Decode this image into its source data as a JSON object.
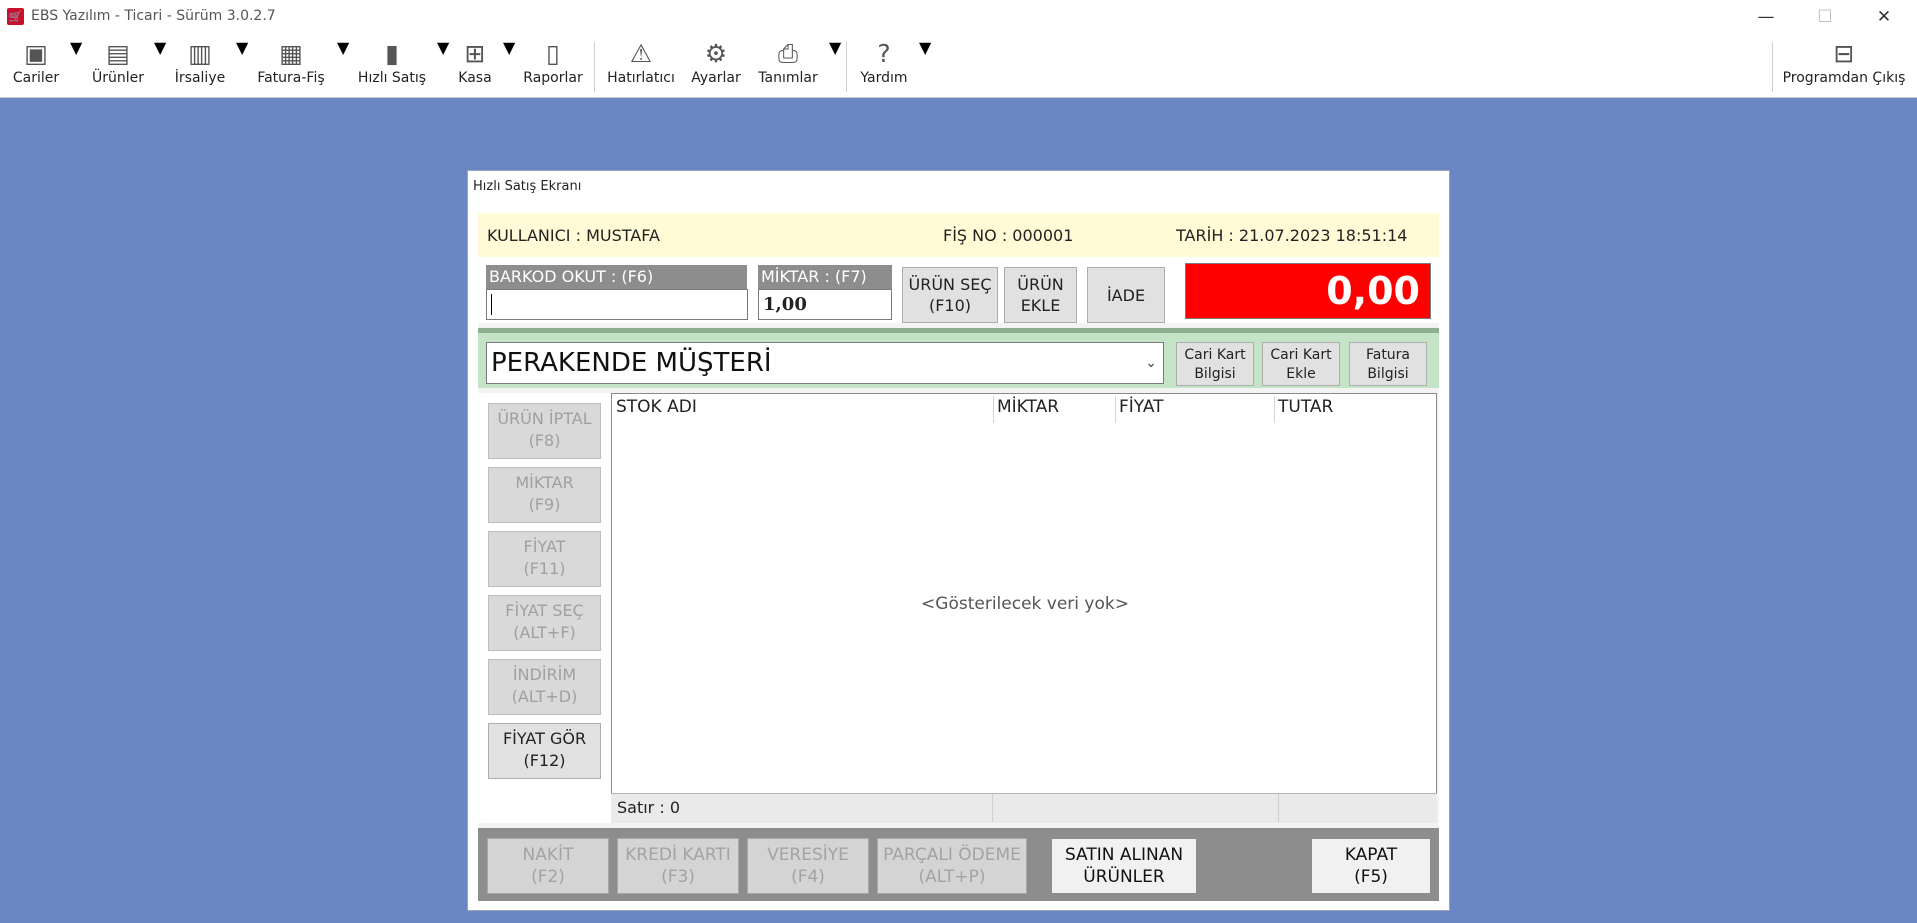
{
  "window": {
    "title": "EBS Yazılım - Ticari - Sürüm 3.0.2.7"
  },
  "toolbar": {
    "items": [
      {
        "label": "Cariler",
        "icon": "safe-icon"
      },
      {
        "label": "Ürünler",
        "icon": "boxes-icon"
      },
      {
        "label": "İrsaliye",
        "icon": "document-icon"
      },
      {
        "label": "Fatura-Fiş",
        "icon": "invoice-icon"
      },
      {
        "label": "Hızlı Satış",
        "icon": "barcode-icon"
      },
      {
        "label": "Kasa",
        "icon": "cash-register-icon"
      },
      {
        "label": "Raporlar",
        "icon": "book-icon"
      },
      {
        "label": "Hatırlatıcı",
        "icon": "warning-icon"
      },
      {
        "label": "Ayarlar",
        "icon": "joystick-icon"
      },
      {
        "label": "Tanımlar",
        "icon": "printer-icon"
      },
      {
        "label": "Yardım",
        "icon": "help-icon"
      },
      {
        "label": "Programdan Çıkış",
        "icon": "exit-door-icon"
      }
    ]
  },
  "dialog": {
    "title": "Hızlı Satış Ekranı",
    "user_label": "KULLANICI : ",
    "user": "MUSTAFA",
    "receipt_label": "FİŞ NO : ",
    "receipt_no": "000001",
    "date_label": "TARİH : ",
    "date": "21.07.2023 18:51:14",
    "barcode_label": "BARKOD OKUT : (F6)",
    "barcode_value": "",
    "quantity_label": "MİKTAR : (F7)",
    "quantity_value": "1,00",
    "select_product": [
      "ÜRÜN SEÇ",
      "(F10)"
    ],
    "add_product": [
      "ÜRÜN",
      "EKLE"
    ],
    "return_label": "İADE",
    "total": "0,00",
    "customer": "PERAKENDE MÜŞTERİ",
    "account_info": [
      "Cari Kart",
      "Bilgisi"
    ],
    "account_add": [
      "Cari Kart",
      "Ekle"
    ],
    "invoice_info": [
      "Fatura",
      "Bilgisi"
    ],
    "side_buttons": [
      [
        "ÜRÜN İPTAL",
        "(F8)"
      ],
      [
        "MİKTAR",
        "(F9)"
      ],
      [
        "FİYAT",
        "(F11)"
      ],
      [
        "FİYAT SEÇ",
        "(ALT+F)"
      ],
      [
        "İNDİRİM",
        "(ALT+D)"
      ],
      [
        "FİYAT GÖR",
        "(F12)"
      ]
    ],
    "grid_columns": [
      "STOK ADI",
      "MİKTAR",
      "FİYAT",
      "TUTAR"
    ],
    "empty_text": "<Gösterilecek veri yok>",
    "row_count": "Satır : 0",
    "payment_buttons": [
      [
        "NAKİT",
        "(F2)"
      ],
      [
        "KREDİ KARTI",
        "(F3)"
      ],
      [
        "VERESİYE",
        "(F4)"
      ],
      [
        "PARÇALI ÖDEME",
        "(ALT+P)"
      ],
      [
        "SATIN ALINAN",
        "ÜRÜNLER"
      ],
      [
        "KAPAT",
        "(F5)"
      ]
    ]
  }
}
